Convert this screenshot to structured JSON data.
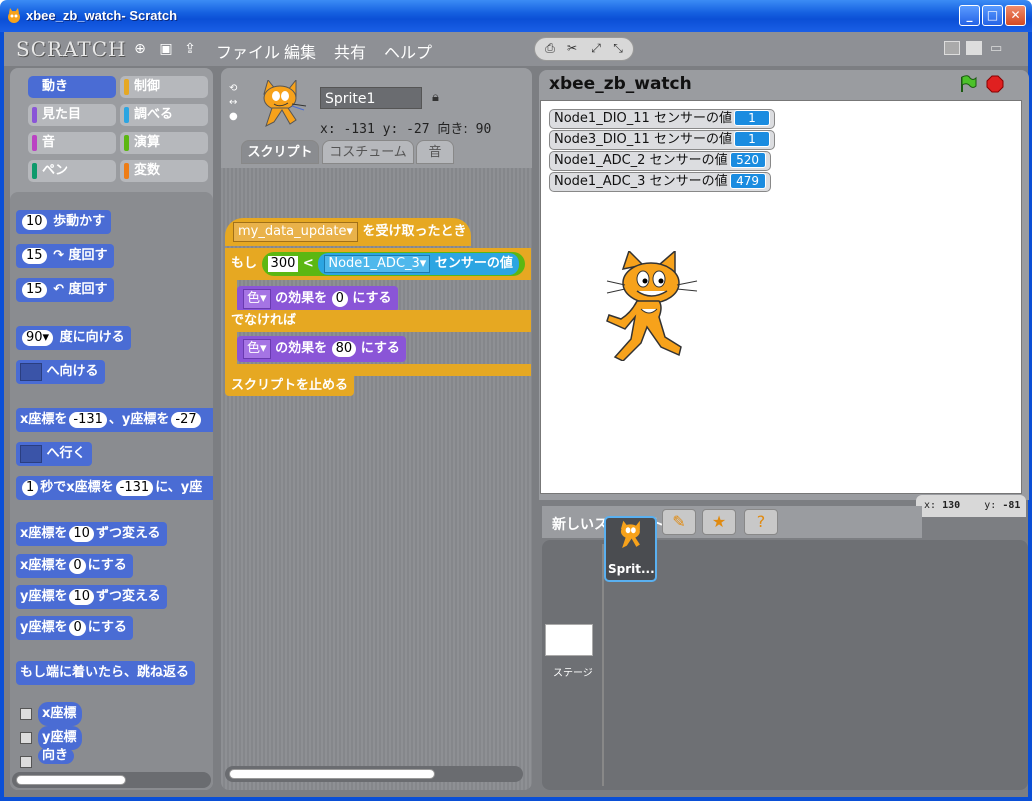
{
  "window": {
    "title": "xbee_zb_watch- Scratch",
    "minimize": "_",
    "maximize": "□",
    "close": "✕"
  },
  "menubar": {
    "logo": "SCRATCH",
    "items": [
      "ファイル",
      "編集",
      "共有",
      "ヘルプ"
    ]
  },
  "categories": [
    {
      "label": "動き",
      "color": "#4a6cd4"
    },
    {
      "label": "制御",
      "color": "#e6a822"
    },
    {
      "label": "見た目",
      "color": "#8a55d7"
    },
    {
      "label": "調べる",
      "color": "#2ca5e2"
    },
    {
      "label": "音",
      "color": "#bb42c3"
    },
    {
      "label": "演算",
      "color": "#5cb712"
    },
    {
      "label": "ペン",
      "color": "#0e9a6c"
    },
    {
      "label": "変数",
      "color": "#ee7d16"
    }
  ],
  "palette_blocks": {
    "move": {
      "n": "10",
      "t": "歩動かす"
    },
    "turn_right": {
      "n": "15",
      "t": "↷ 度回す"
    },
    "turn_left": {
      "n": "15",
      "t": "↶ 度回す"
    },
    "point_dir": {
      "n": "90▾",
      "t": "度に向ける"
    },
    "point_towards": {
      "t": "へ向ける"
    },
    "goto_xy": {
      "a": "x座標を",
      "x": "-131",
      "b": "、y座標を",
      "y": "-27"
    },
    "goto": {
      "t": "へ行く"
    },
    "glide": {
      "n": "1",
      "a": "秒でx座標を",
      "x": "-131",
      "b": "に、y座"
    },
    "change_x": {
      "a": "x座標を",
      "n": "10",
      "b": "ずつ変える"
    },
    "set_x": {
      "a": "x座標を",
      "n": "0",
      "b": "にする"
    },
    "change_y": {
      "a": "y座標を",
      "n": "10",
      "b": "ずつ変える"
    },
    "set_y": {
      "a": "y座標を",
      "n": "0",
      "b": "にする"
    },
    "bounce": {
      "t": "もし端に着いたら、跳ね返る"
    },
    "rep_x": "x座標",
    "rep_y": "y座標",
    "rep_dir": "向き"
  },
  "sprite": {
    "name": "Sprite1",
    "coords": "x: -131  y: -27",
    "direction_label": "向き:",
    "direction": "90"
  },
  "tabs": [
    "スクリプト",
    "コスチューム",
    "音"
  ],
  "script": {
    "hat_input": "my_data_update▾",
    "hat_text": "を受け取ったとき",
    "if_label": "もし",
    "lt_left": "300",
    "lt_op": "<",
    "sensor_input": "Node1_ADC_3▾",
    "sensor_text": "センサーの値",
    "effect1_input": "色▾",
    "effect1_text": "の効果を",
    "effect1_val": "0",
    "effect1_tail": "にする",
    "else_label": "でなければ",
    "effect2_input": "色▾",
    "effect2_text": "の効果を",
    "effect2_val": "80",
    "effect2_tail": "にする",
    "stop_label": "スクリプトを止める"
  },
  "stage": {
    "title": "xbee_zb_watch",
    "monitors": [
      {
        "label": "Node1_DIO_11 センサーの値",
        "value": "1"
      },
      {
        "label": "Node3_DIO_11 センサーの値",
        "value": "1"
      },
      {
        "label": "Node1_ADC_2 センサーの値",
        "value": "520"
      },
      {
        "label": "Node1_ADC_3 センサーの値",
        "value": "479"
      }
    ]
  },
  "mouse": {
    "x_label": "x:",
    "x": "130",
    "y_label": "y:",
    "y": "-81"
  },
  "new_sprite_label": "新しいスプライト:",
  "sprite_list": {
    "stage_label": "ステージ",
    "sprite_label": "Sprit..."
  },
  "colors": {
    "motion": "#4a6cd4",
    "control": "#e6a822",
    "looks": "#8a55d7",
    "operators": "#5cb712",
    "sensing": "#2ca5e2",
    "monitor_value": "#1a8ce0"
  }
}
